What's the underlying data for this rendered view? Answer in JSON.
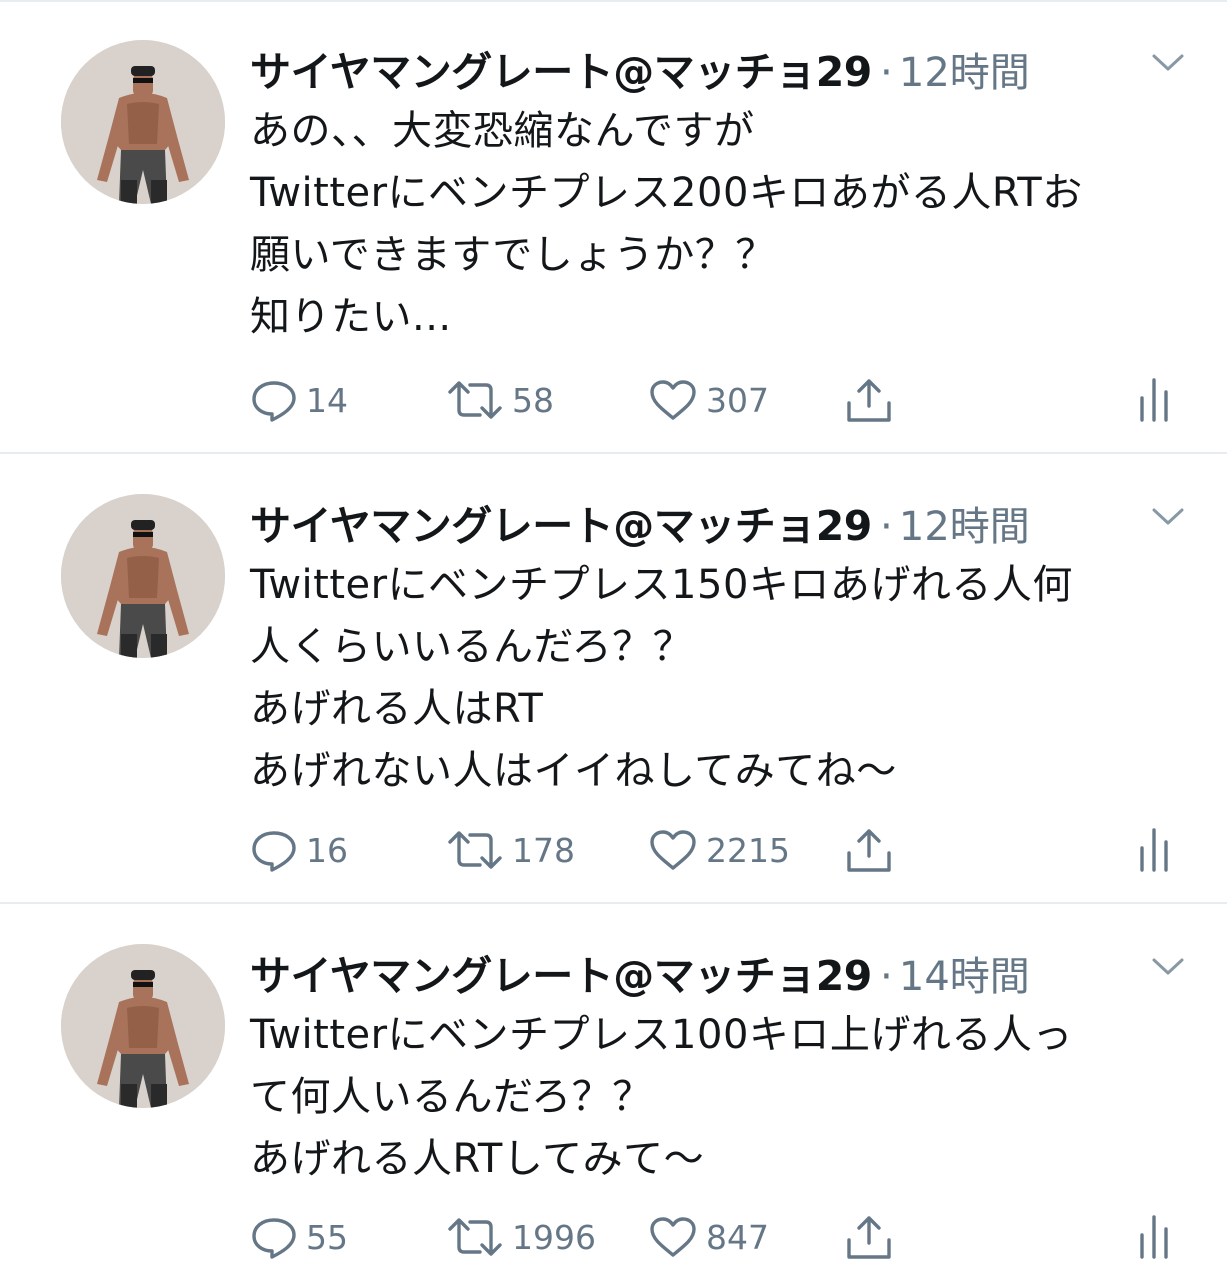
{
  "tweets": [
    {
      "name": "サイヤマングレート@マッチョ29",
      "separator": "·",
      "time": "12時間",
      "lines": [
        "あの、、大変恐縮なんですが",
        "Twitterにベンチプレス200キロあがる人RTお",
        "願いできますでしょうか？？",
        "知りたい..."
      ],
      "replies": "14",
      "retweets": "58",
      "likes": "307"
    },
    {
      "name": "サイヤマングレート@マッチョ29",
      "separator": "·",
      "time": "12時間",
      "lines": [
        "Twitterにベンチプレス150キロあげれる人何",
        "人くらいいるんだろ？？",
        "あげれる人はRT",
        "あげれない人はイイねしてみてね〜"
      ],
      "replies": "16",
      "retweets": "178",
      "likes": "2215"
    },
    {
      "name": "サイヤマングレート@マッチョ29",
      "separator": "·",
      "time": "14時間",
      "lines": [
        "Twitterにベンチプレス100キロ上げれる人っ",
        "て何人いるんだろ？？",
        "あげれる人RTしてみて〜"
      ],
      "replies": "55",
      "retweets": "1996",
      "likes": "847"
    }
  ],
  "icons": {
    "avatar": "avatar-photo",
    "chevron": "chevron-down-icon",
    "reply": "reply-icon",
    "retweet": "retweet-icon",
    "like": "heart-icon",
    "share": "share-icon",
    "stats": "analytics-icon"
  },
  "colors": {
    "text": "#14171a",
    "muted": "#657786",
    "divider": "#e6ecf0",
    "avatar_bg": "#d9d2cc"
  }
}
